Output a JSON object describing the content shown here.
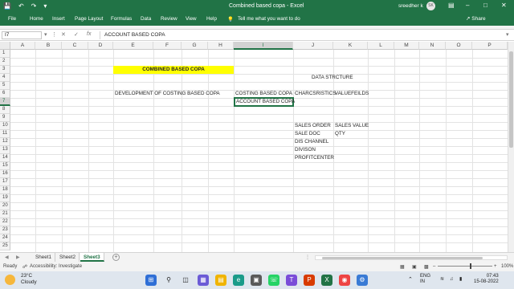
{
  "titlebar": {
    "autosave_label": "File",
    "title": "Combined based copa  -  Excel",
    "user": "sreedher k",
    "avatar_initials": "SK",
    "qa_icons": [
      "save-icon",
      "undo-icon",
      "redo-icon",
      "customize-icon"
    ]
  },
  "ribbon": {
    "tabs": [
      "File",
      "Home",
      "Insert",
      "Page Layout",
      "Formulas",
      "Data",
      "Review",
      "View",
      "Help"
    ],
    "tell_me": "Tell me what you want to do",
    "share": "Share"
  },
  "formula_bar": {
    "name_box": "I7",
    "formula": "ACCOUNT BASED COPA"
  },
  "grid": {
    "columns": [
      "A",
      "B",
      "C",
      "D",
      "E",
      "F",
      "G",
      "H",
      "I",
      "J",
      "K",
      "L",
      "M",
      "N",
      "O",
      "P"
    ],
    "rows": [
      "1",
      "2",
      "3",
      "4",
      "5",
      "6",
      "7",
      "8",
      "9",
      "10",
      "11",
      "12",
      "13",
      "14",
      "15",
      "16",
      "17",
      "18",
      "19",
      "20",
      "21",
      "22",
      "23",
      "24",
      "25"
    ],
    "selected_column": "I",
    "selected_row": "7",
    "cells": {
      "e3": "COMBINED BASED COPA",
      "j4": "DATA STRCTURE",
      "e6": "DEVELOPMENT OF COSTING BASED COPA",
      "i6": "COSTING BASED COPA",
      "j6": "CHARCSRISTICS",
      "k6": "VALUEFEILDS",
      "i7": "ACCOUNT BASED COPA",
      "j10": "SALES ORDER",
      "k10": "SALES VALUE",
      "j11": "SALE DOC",
      "k11": "QTY",
      "j12": "DIS CHANNEL",
      "j13": "DIVISON",
      "j14": "PROFITCENTER"
    },
    "highlight_color": "#ffff00"
  },
  "sheets": {
    "tabs": [
      "Sheet1",
      "Sheet2",
      "Sheet3"
    ],
    "active": "Sheet3"
  },
  "status": {
    "ready": "Ready",
    "accessibility": "Accessibility: Investigate",
    "zoom": "100%"
  },
  "taskbar": {
    "temperature": "23°C",
    "condition": "Cloudy",
    "lang1": "ENG",
    "lang2": "IN",
    "time": "07:43",
    "date": "15-08-2022"
  },
  "colors": {
    "excel_green": "#217346",
    "taskbar_bg": "#dfe6ee"
  }
}
